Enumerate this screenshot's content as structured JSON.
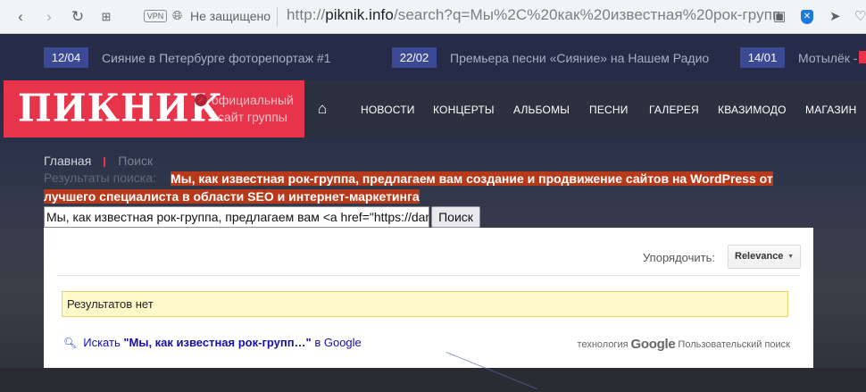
{
  "browser": {
    "vpn_label": "VPN",
    "security_text": "Не защищено",
    "url_prefix": "http://",
    "url_host": "piknik.info",
    "url_rest": "/search?q=Мы%2C%20как%20известная%20рок-групп",
    "icons": [
      "back-icon",
      "forward-icon",
      "reload-icon",
      "grid-icon",
      "camera-icon",
      "shield-icon",
      "send-icon",
      "heart-icon"
    ]
  },
  "ticker": [
    {
      "date": "12/04",
      "text": "Сияние в Петербурге фоторепортаж #1"
    },
    {
      "date": "22/02",
      "text": "Премьера песни «Сияние» на Нашем Радио"
    },
    {
      "date": "14/01",
      "text": "Мотылёк - в"
    }
  ],
  "header": {
    "logo": "ПИКНИК",
    "tagline_line1": "официальный",
    "tagline_line2": "сайт группы",
    "nav": [
      "НОВОСТИ",
      "КОНЦЕРТЫ",
      "АЛЬБОМЫ",
      "ПЕСНИ",
      "ГАЛЕРЕЯ",
      "КВАЗИМОДО",
      "МАГАЗИН"
    ]
  },
  "breadcrumb": {
    "home": "Главная",
    "current": "Поиск"
  },
  "search": {
    "ghost_label": "Результаты поиска:",
    "query_line1": "Мы, как известная рок-группа, предлагаем вам создание и продвижение сайтов на WordPress от",
    "query_line2": "лучшего специалиста в области SEO и интернет-маркетинга",
    "input_value": "Мы, как известная рок-группа, предлагаем вам <a href=\"https://dar",
    "button_label": "Поиск"
  },
  "results": {
    "sort_label": "Упорядочить:",
    "sort_value": "Relevance",
    "no_results": "Результатов нет",
    "google_prefix": "Искать ",
    "google_term": "\"Мы, как известная рок-групп…\"",
    "google_suffix": " в Google",
    "powered_prefix": "технология",
    "powered_brand": "Google",
    "powered_suffix": "Пользовательский поиск"
  },
  "colors": {
    "brand_red": "#e8344b",
    "ticker_date": "#3c4a96",
    "highlight": "#b63a1a",
    "no_results_bg": "#fff8c9"
  }
}
